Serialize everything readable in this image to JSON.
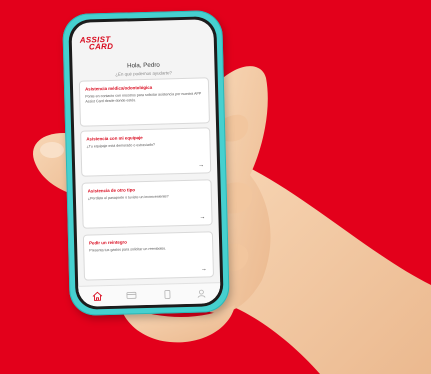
{
  "brand": {
    "line1": "ASSIST",
    "line2": "CARD"
  },
  "header": {
    "greeting": "Hola, Pedro",
    "subtitle": "¿En qué podemos ayudarte?"
  },
  "cards": [
    {
      "title": "Asistencia médica/odontológica",
      "description": "Ponte en contacto con nosotros para solicitar asistencia por nuestra APP Assist Card desde donde estés."
    },
    {
      "title": "Asistencia con mi equipaje",
      "description": "¿Tu equipaje está demorado o extraviado?"
    },
    {
      "title": "Asistencia de otro tipo",
      "description": "¿Perdiste el pasaporte o tuviste un inconveniente?"
    },
    {
      "title": "Pedir un reintegro",
      "description": "Presenta tus gastos para solicitar un reembolso."
    }
  ],
  "arrow_glyph": "→",
  "nav": {
    "items": [
      {
        "icon": "home-icon",
        "active": true
      },
      {
        "icon": "card-icon",
        "active": false
      },
      {
        "icon": "document-icon",
        "active": false
      },
      {
        "icon": "profile-icon",
        "active": false
      }
    ]
  },
  "colors": {
    "background": "#e3001b",
    "brand_red": "#d90a1e",
    "phone_case": "#46d0cf",
    "skin": "#f4cba6"
  }
}
